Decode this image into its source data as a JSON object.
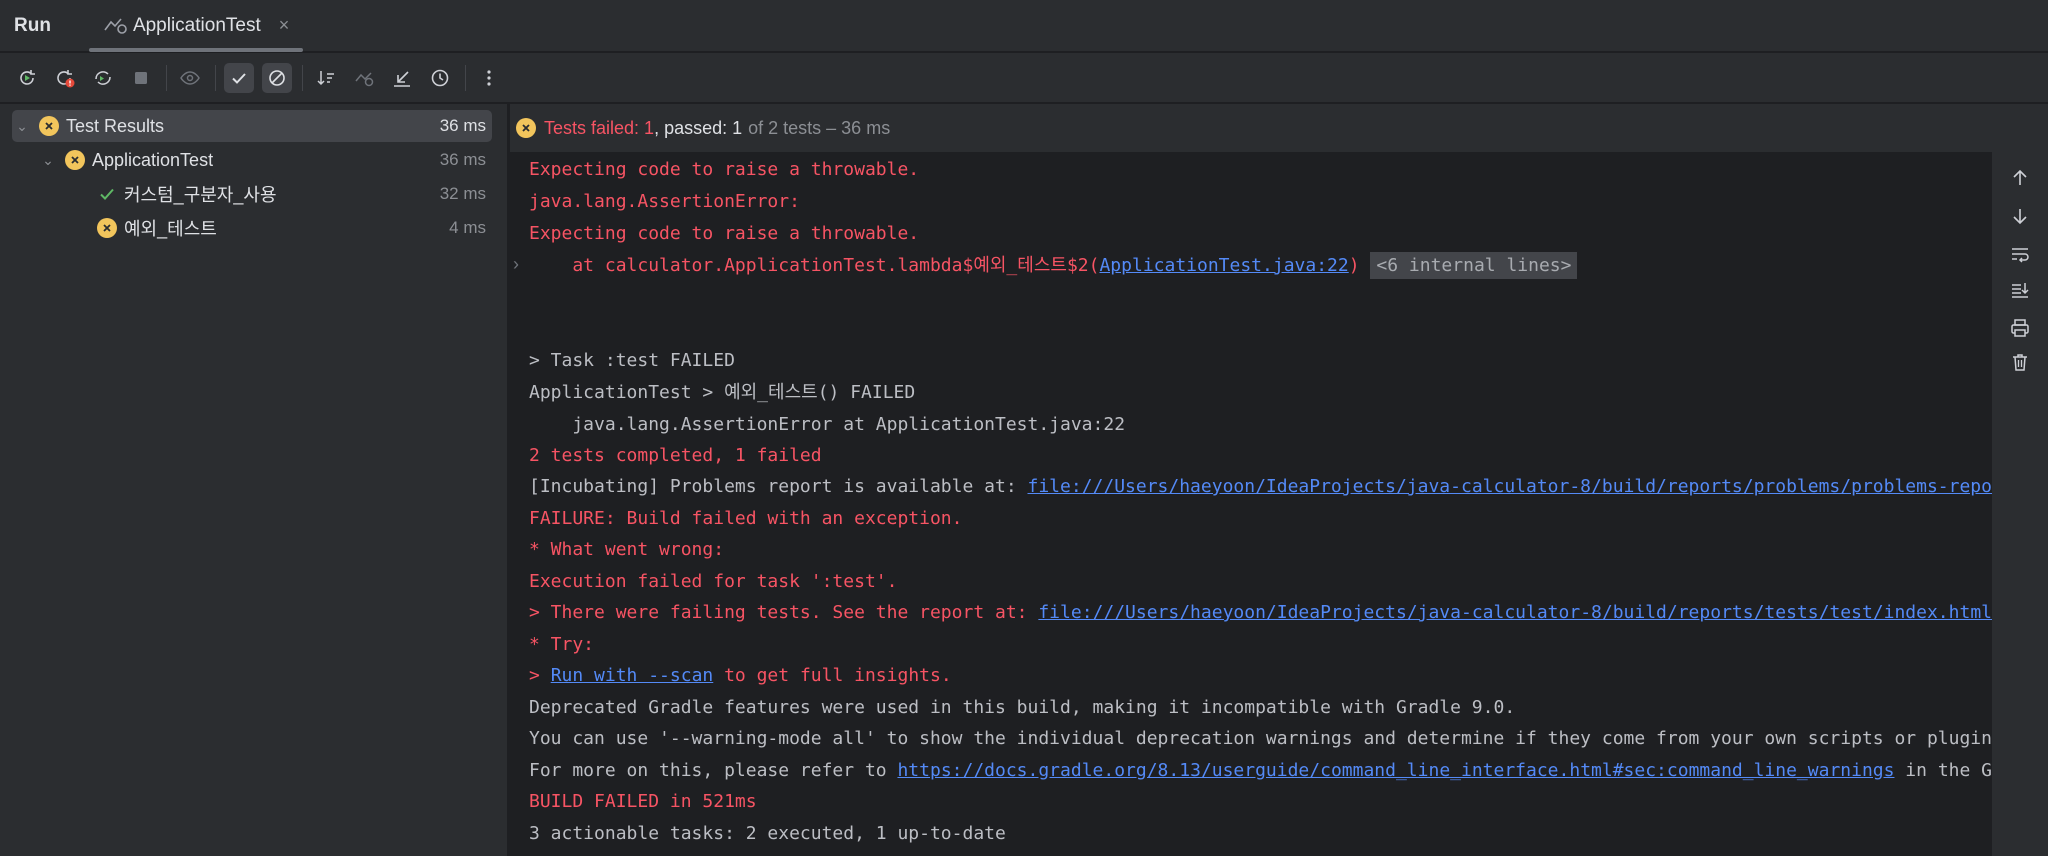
{
  "titlebar": {
    "run_label": "Run",
    "tab_title": "ApplicationTest",
    "tab_close": "×"
  },
  "toolbar": {
    "buttons": [
      {
        "icon": "rerun-icon"
      },
      {
        "icon": "rerun-failed-icon"
      },
      {
        "icon": "toggle-auto-test-icon"
      },
      {
        "icon": "stop-icon"
      },
      {
        "icon": "show-ignored-icon"
      },
      {
        "icon": "show-passed-icon",
        "active": true
      },
      {
        "icon": "show-ignored-tests-icon",
        "active": true
      },
      {
        "icon": "sort-icon"
      },
      {
        "icon": "import-tests-icon"
      },
      {
        "icon": "collapse-icon"
      },
      {
        "icon": "history-icon"
      },
      {
        "icon": "more-icon"
      }
    ]
  },
  "tree": {
    "root": {
      "label": "Test Results",
      "time": "36 ms",
      "status": "failed"
    },
    "class": {
      "label": "ApplicationTest",
      "time": "36 ms",
      "status": "failed"
    },
    "tests": [
      {
        "label": "커스텀_구분자_사용",
        "time": "32 ms",
        "status": "passed"
      },
      {
        "label": "예외_테스트",
        "time": "4 ms",
        "status": "failed"
      }
    ]
  },
  "summary": {
    "failed_text": "Tests failed: 1",
    "passed_text": ", passed: 1",
    "total_text": "of 2 tests – 36 ms"
  },
  "console": {
    "l1": "Expecting code to raise a throwable.",
    "l2": "java.lang.AssertionError:",
    "l3": "Expecting code to raise a throwable.",
    "l4_prefix": "    at calculator.ApplicationTest.lambda$예외_테스트$2(",
    "l4_link": "ApplicationTest.java:22",
    "l4_suffix": ")",
    "l4_internal": "<6 internal lines>",
    "l5": "> Task :test FAILED",
    "l6": "ApplicationTest > 예외_테스트() FAILED",
    "l7": "    java.lang.AssertionError at ApplicationTest.java:22",
    "l8": "2 tests completed, 1 failed",
    "l9_prefix": "[Incubating] Problems report is available at: ",
    "l9_link": "file:///Users/haeyoon/IdeaProjects/java-calculator-8/build/reports/problems/problems-report.html",
    "l10": "FAILURE: Build failed with an exception.",
    "l11": "* What went wrong:",
    "l12": "Execution failed for task ':test'.",
    "l13_prefix": "> There were failing tests. See the report at: ",
    "l13_link": "file:///Users/haeyoon/IdeaProjects/java-calculator-8/build/reports/tests/test/index.html",
    "l14": "* Try:",
    "l15_prefix": "> ",
    "l15_link": "Run with --scan",
    "l15_suffix": " to get full insights.",
    "l16": "Deprecated Gradle features were used in this build, making it incompatible with Gradle 9.0.",
    "l17": "You can use '--warning-mode all' to show the individual deprecation warnings and determine if they come from your own scripts or plugins.",
    "l18_prefix": "For more on this, please refer to ",
    "l18_link": "https://docs.gradle.org/8.13/userguide/command_line_interface.html#sec:command_line_warnings",
    "l18_suffix": " in the Gradle documentation.",
    "l19": "BUILD FAILED in 521ms",
    "l20": "3 actionable tasks: 2 executed, 1 up-to-date"
  },
  "gutter": [
    "arrow-up-icon",
    "arrow-down-icon",
    "soft-wrap-icon",
    "scroll-to-end-icon",
    "print-icon",
    "trash-icon"
  ]
}
